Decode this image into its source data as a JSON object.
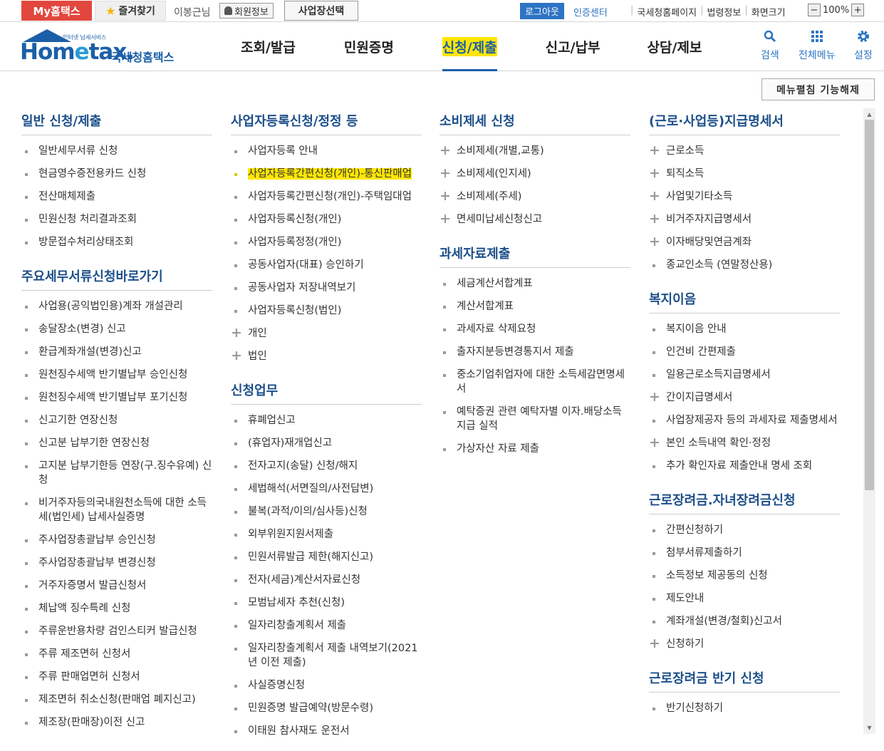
{
  "topbar": {
    "my_hometax": "My홈택스",
    "favorites": "즐겨찾기",
    "user_name": "이봉근님",
    "member_info": "회원정보",
    "business_select": "사업장선택",
    "logout": "로그아웃",
    "cert_center": "인증센터",
    "links": [
      "국세청홈페이지",
      "법령정보",
      "화면크기"
    ],
    "zoom_level": "100%",
    "zoom_minus": "−",
    "zoom_plus": "+"
  },
  "header": {
    "logo_tagline": "인터넷 납세서비스",
    "logo_word_1": "Hom",
    "logo_word_e": "e",
    "logo_word_2": "tax.",
    "logo_kor": "국세청홈택스",
    "nav": [
      "조회/발급",
      "민원증명",
      "신청/제출",
      "신고/납부",
      "상담/제보"
    ],
    "active_nav": "신청/제출",
    "util": [
      {
        "label": "검색",
        "icon": "search-icon"
      },
      {
        "label": "전체메뉴",
        "icon": "grid-icon"
      },
      {
        "label": "설정",
        "icon": "gear-icon"
      }
    ]
  },
  "menu_toggle": "메뉴펼침 기능해제",
  "columns": [
    {
      "sections": [
        {
          "title": "일반 신청/제출",
          "items": [
            {
              "label": "일반세무서류 신청",
              "type": "dot"
            },
            {
              "label": "현금영수증전용카드 신청",
              "type": "dot"
            },
            {
              "label": "전산매체제출",
              "type": "dot"
            },
            {
              "label": "민원신청 처리결과조회",
              "type": "dot"
            },
            {
              "label": "방문접수처리상태조회",
              "type": "dot"
            }
          ]
        },
        {
          "title": "주요세무서류신청바로가기",
          "items": [
            {
              "label": "사업용(공익법인용)계좌 개설관리",
              "type": "dot"
            },
            {
              "label": "송달장소(변경) 신고",
              "type": "dot"
            },
            {
              "label": "환급계좌개설(변경)신고",
              "type": "dot"
            },
            {
              "label": "원천징수세액 반기별납부 승인신청",
              "type": "dot"
            },
            {
              "label": "원천징수세액 반기별납부 포기신청",
              "type": "dot"
            },
            {
              "label": "신고기한 연장신청",
              "type": "dot"
            },
            {
              "label": "신고분 납부기한 연장신청",
              "type": "dot"
            },
            {
              "label": "고지분 납부기한등 연장(구.징수유예) 신청",
              "type": "dot"
            },
            {
              "label": "비거주자등의국내원천소득에 대한 소득세(법인세) 납세사실증명",
              "type": "dot"
            },
            {
              "label": "주사업장총괄납부 승인신청",
              "type": "dot"
            },
            {
              "label": "주사업장총괄납부 변경신청",
              "type": "dot"
            },
            {
              "label": "거주자증명서 발급신청서",
              "type": "dot"
            },
            {
              "label": "체납액 징수특례 신청",
              "type": "dot"
            },
            {
              "label": "주류운반용차량 검인스티커 발급신청",
              "type": "dot"
            },
            {
              "label": "주류 제조면허 신청서",
              "type": "dot"
            },
            {
              "label": "주류 판매업면허 신청서",
              "type": "dot"
            },
            {
              "label": "제조면허 취소신청(판매업 폐지신고)",
              "type": "dot"
            },
            {
              "label": "제조장(판매장)이전 신고",
              "type": "dot"
            }
          ]
        }
      ]
    },
    {
      "sections": [
        {
          "title": "사업자등록신청/정정 등",
          "items": [
            {
              "label": "사업자등록 안내",
              "type": "dot"
            },
            {
              "label": "사업자등록간편신청(개인)-통신판매업",
              "type": "dot",
              "highlight": true
            },
            {
              "label": "사업자등록간편신청(개인)-주택임대업",
              "type": "dot"
            },
            {
              "label": "사업자등록신청(개인)",
              "type": "dot"
            },
            {
              "label": "사업자등록정정(개인)",
              "type": "dot"
            },
            {
              "label": "공동사업자(대표) 승인하기",
              "type": "dot"
            },
            {
              "label": "공동사업자 저장내역보기",
              "type": "dot"
            },
            {
              "label": "사업자등록신청(법인)",
              "type": "dot"
            },
            {
              "label": "개인",
              "type": "plus"
            },
            {
              "label": "법인",
              "type": "plus"
            }
          ]
        },
        {
          "title": "신청업무",
          "items": [
            {
              "label": "휴폐업신고",
              "type": "dot"
            },
            {
              "label": "(휴업자)재개업신고",
              "type": "dot"
            },
            {
              "label": "전자고지(송달) 신청/해지",
              "type": "dot"
            },
            {
              "label": "세법해석(서면질의/사전답변)",
              "type": "dot"
            },
            {
              "label": "불복(과적/이의/심사등)신청",
              "type": "dot"
            },
            {
              "label": "외부위원지원서제출",
              "type": "dot"
            },
            {
              "label": "민원서류발급 제한(해지신고)",
              "type": "dot"
            },
            {
              "label": "전자(세금)계산서자료신청",
              "type": "dot"
            },
            {
              "label": "모범납세자 추천(신청)",
              "type": "dot"
            },
            {
              "label": "일자리창출계획서 제출",
              "type": "dot"
            },
            {
              "label": "일자리창출계획서 제출 내역보기(2021년 이전 제출)",
              "type": "dot"
            },
            {
              "label": "사실증명신청",
              "type": "dot"
            },
            {
              "label": "민원증명 발급예약(방문수령)",
              "type": "dot"
            },
            {
              "label": "이태원 참사재도 운전서",
              "type": "dot"
            }
          ]
        }
      ]
    },
    {
      "sections": [
        {
          "title": "소비제세 신청",
          "items": [
            {
              "label": "소비제세(개별,교통)",
              "type": "plus"
            },
            {
              "label": "소비제세(인지세)",
              "type": "plus"
            },
            {
              "label": "소비제세(주세)",
              "type": "plus"
            },
            {
              "label": "면세미납세신청신고",
              "type": "plus"
            }
          ]
        },
        {
          "title": "과세자료제출",
          "items": [
            {
              "label": "세금계산서합계표",
              "type": "dot"
            },
            {
              "label": "계산서합계표",
              "type": "dot"
            },
            {
              "label": "과세자료 삭제요청",
              "type": "dot"
            },
            {
              "label": "출자지분등변경통지서 제출",
              "type": "dot"
            },
            {
              "label": "중소기업취업자에 대한 소득세감면명세서",
              "type": "dot"
            },
            {
              "label": "예탁증권 관련 예탁자별 이자.배당소득 지급 실적",
              "type": "dot"
            },
            {
              "label": "가상자산 자료 제출",
              "type": "dot"
            }
          ]
        }
      ]
    },
    {
      "sections": [
        {
          "title": "(근로·사업등)지급명세서",
          "items": [
            {
              "label": "근로소득",
              "type": "plus"
            },
            {
              "label": "퇴직소득",
              "type": "plus"
            },
            {
              "label": "사업및기타소득",
              "type": "plus"
            },
            {
              "label": "비거주자지급명세서",
              "type": "plus"
            },
            {
              "label": "이자배당및연금계좌",
              "type": "plus"
            },
            {
              "label": "종교인소득 (연말정산용)",
              "type": "dot"
            }
          ]
        },
        {
          "title": "복지이음",
          "items": [
            {
              "label": "복지이음 안내",
              "type": "dot"
            },
            {
              "label": "인건비 간편제출",
              "type": "dot"
            },
            {
              "label": "일용근로소득지급명세서",
              "type": "dot"
            },
            {
              "label": "간이지급명세서",
              "type": "plus"
            },
            {
              "label": "사업장제공자 등의 과세자료 제출명세서",
              "type": "dot"
            },
            {
              "label": "본인 소득내역 확인·정정",
              "type": "plus"
            },
            {
              "label": "추가 확인자료 제출안내 명세 조회",
              "type": "dot"
            }
          ]
        },
        {
          "title": "근로장려금.자녀장려금신청",
          "items": [
            {
              "label": "간편신청하기",
              "type": "dot"
            },
            {
              "label": "첨부서류제출하기",
              "type": "dot"
            },
            {
              "label": "소득정보 제공동의 신청",
              "type": "dot"
            },
            {
              "label": "제도안내",
              "type": "dot"
            },
            {
              "label": "계좌개설(변경/철회)신고서",
              "type": "dot"
            },
            {
              "label": "신청하기",
              "type": "plus"
            }
          ]
        },
        {
          "title": "근로장려금 반기 신청",
          "items": [
            {
              "label": "반기신청하기",
              "type": "dot"
            }
          ]
        }
      ]
    }
  ]
}
